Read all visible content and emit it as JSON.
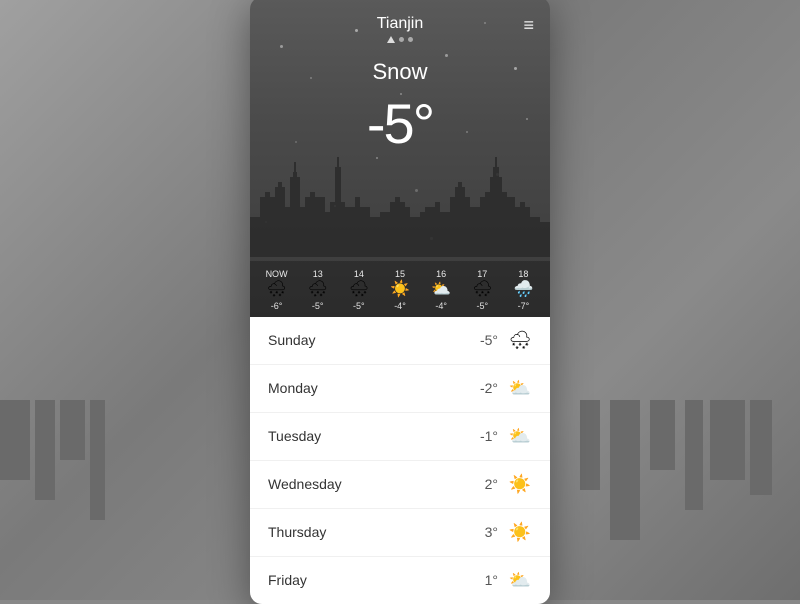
{
  "background": {
    "color": "#878787"
  },
  "app": {
    "city": "Tianjin",
    "condition": "Snow",
    "temperature": "-5°",
    "menu_icon": "≡",
    "dots": [
      "active",
      "inactive",
      "inactive"
    ]
  },
  "hourly": [
    {
      "label": "NOW",
      "icon": "snow",
      "temp": "-6°"
    },
    {
      "label": "13",
      "icon": "snow",
      "temp": "-5°"
    },
    {
      "label": "14",
      "icon": "snow",
      "temp": "-5°"
    },
    {
      "label": "15",
      "icon": "sun",
      "temp": "-4°"
    },
    {
      "label": "16",
      "icon": "cloud-sun",
      "temp": "-4°"
    },
    {
      "label": "17",
      "icon": "snow",
      "temp": "-5°"
    },
    {
      "label": "18",
      "icon": "rain",
      "temp": "-7°"
    }
  ],
  "daily": [
    {
      "day": "Sunday",
      "temp": "-5°",
      "icon": "snow"
    },
    {
      "day": "Monday",
      "temp": "-2°",
      "icon": "cloud-sun"
    },
    {
      "day": "Tuesday",
      "temp": "-1°",
      "icon": "cloud-sun"
    },
    {
      "day": "Wednesday",
      "temp": "2°",
      "icon": "sun"
    },
    {
      "day": "Thursday",
      "temp": "3°",
      "icon": "sun"
    },
    {
      "day": "Friday",
      "temp": "1°",
      "icon": "cloud-sun"
    }
  ],
  "icons": {
    "snow": "🌨",
    "cloud-sun": "⛅",
    "sun": "☀️",
    "rain": "🌧️",
    "cloud": "☁️"
  }
}
